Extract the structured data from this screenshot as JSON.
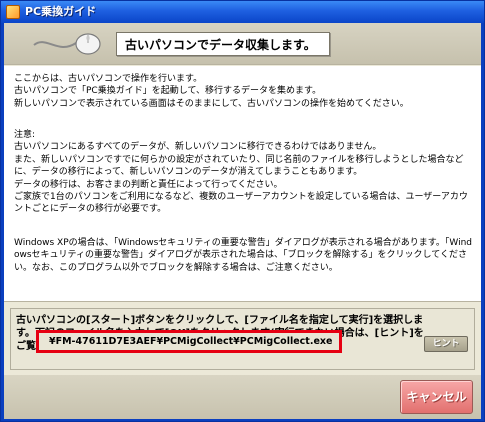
{
  "window": {
    "title": "PC乗換ガイド"
  },
  "header": {
    "title": "古いパソコンでデータ収集します。"
  },
  "body": {
    "paragraph_1": "ここからは、古いパソコンで操作を行います。\n古いパソコンで「PC乗換ガイド」を起動して、移行するデータを集めます。\n新しいパソコンで表示されている画面はそのままにして、古いパソコンの操作を始めてください。",
    "paragraph_2": "注意:\n古いパソコンにあるすべてのデータが、新しいパソコンに移行できるわけではありません。\nまた、新しいパソコンですでに何らかの設定がされていたり、同じ名前のファイルを移行しようとした場合などに、データの移行によって、新しいパソコンのデータが消えてしまうこともあります。\nデータの移行は、お客さまの判断と責任によって行ってください。\nご家族で1台のパソコンをご利用になるなど、複数のユーザーアカウントを設定している場合は、ユーザーアカウントごとにデータの移行が必要です。",
    "paragraph_3": "Windows XPの場合は、「Windowsセキュリティの重要な警告」ダイアログが表示される場合があります。「Windowsセキュリティの重要な警告」ダイアログが表示された場合は、「ブロックを解除する」をクリックしてください。なお、このプログラム以外でブロックを解除する場合は、ご注意ください。"
  },
  "instruction": {
    "text": "古いパソコンの[スタート]ボタンをクリックして、[ファイル名を指定して実行]を選択します。下記のファイル名を入力して[OK]をクリックします(実行できない場合は、[ヒント]をご覧ください)。",
    "hint_label": "ヒント",
    "path": "¥FM-47611D7E3AEF¥PCMigCollect¥PCMigCollect.exe"
  },
  "footer": {
    "cancel_label": "キャンセル"
  },
  "colors": {
    "titlebar": "#1e5fe0",
    "highlight_border": "#e60012",
    "cancel_button": "#e2706e"
  }
}
